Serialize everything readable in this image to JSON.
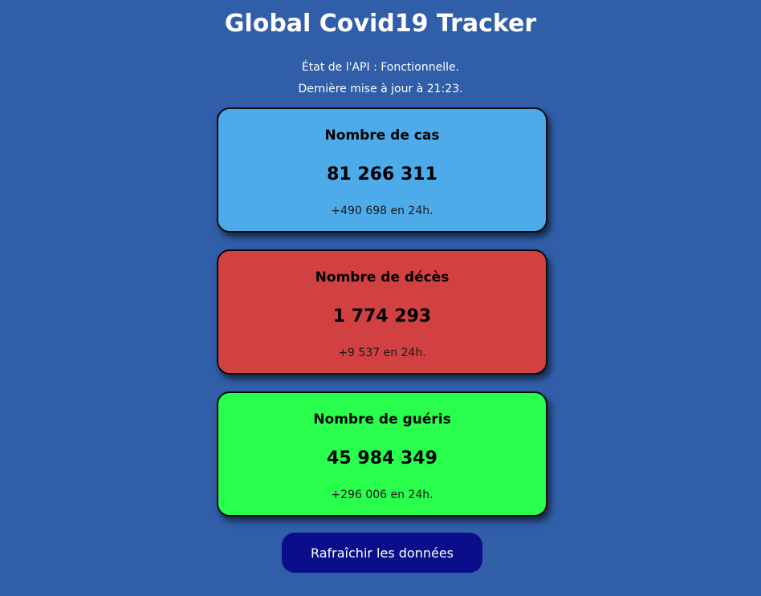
{
  "header": {
    "title": "Global Covid19 Tracker",
    "api_status": "État de l'API : Fonctionnelle.",
    "last_update": "Dernière mise à jour à 21:23."
  },
  "cards": {
    "cases": {
      "title": "Nombre de cas",
      "value": "81 266 311",
      "delta": "+490 698 en 24h.",
      "color": "#4eabea"
    },
    "deaths": {
      "title": "Nombre de décès",
      "value": "1 774 293",
      "delta": "+9 537 en 24h.",
      "color": "#d24142"
    },
    "recovered": {
      "title": "Nombre de guéris",
      "value": "45 984 349",
      "delta": "+296 006 en 24h.",
      "color": "#28fe4b"
    }
  },
  "actions": {
    "refresh_label": "Rafraîchir les données",
    "refresh_color": "#0b0e8a"
  },
  "theme": {
    "background": "#305ea8"
  }
}
